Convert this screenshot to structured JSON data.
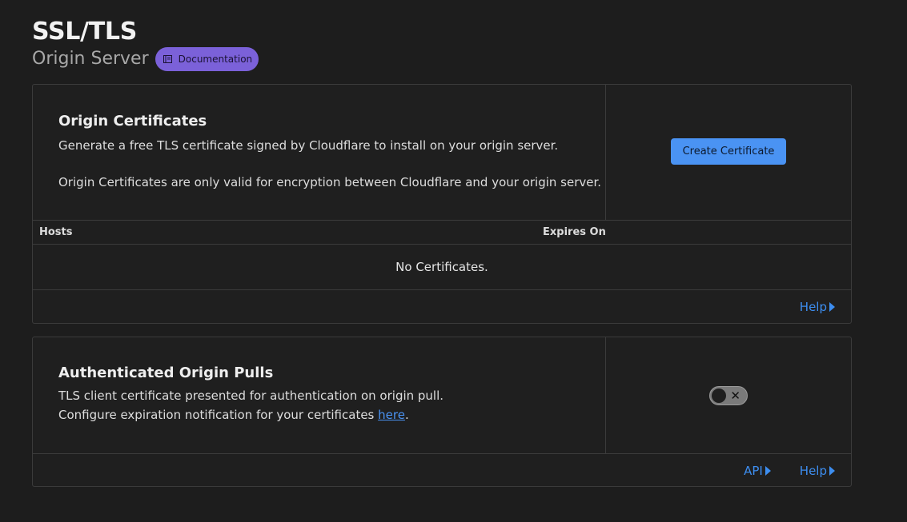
{
  "header": {
    "title": "SSL/TLS",
    "subtitle": "Origin Server",
    "doc_label": "Documentation"
  },
  "origin_certificates": {
    "heading": "Origin Certificates",
    "description_1": "Generate a free TLS certificate signed by Cloudflare to install on your origin server.",
    "description_2": "Origin Certificates are only valid for encryption between Cloudflare and your origin server.",
    "create_button": "Create Certificate",
    "columns": [
      "Hosts",
      "Expires On"
    ],
    "empty_text": "No Certificates.",
    "help_label": "Help"
  },
  "authenticated_origin_pulls": {
    "heading": "Authenticated Origin Pulls",
    "description_1": "TLS client certificate presented for authentication on origin pull.",
    "description_2_prefix": "Configure expiration notification for your certificates ",
    "description_2_link": "here",
    "description_2_suffix": ".",
    "toggle_state": "off",
    "toggle_off_glyph": "✕",
    "api_label": "API",
    "help_label": "Help"
  },
  "colors": {
    "background": "#1d1d1d",
    "accent": "#4a93f3",
    "badge": "#7b61d9",
    "link": "#3d8ef0"
  }
}
